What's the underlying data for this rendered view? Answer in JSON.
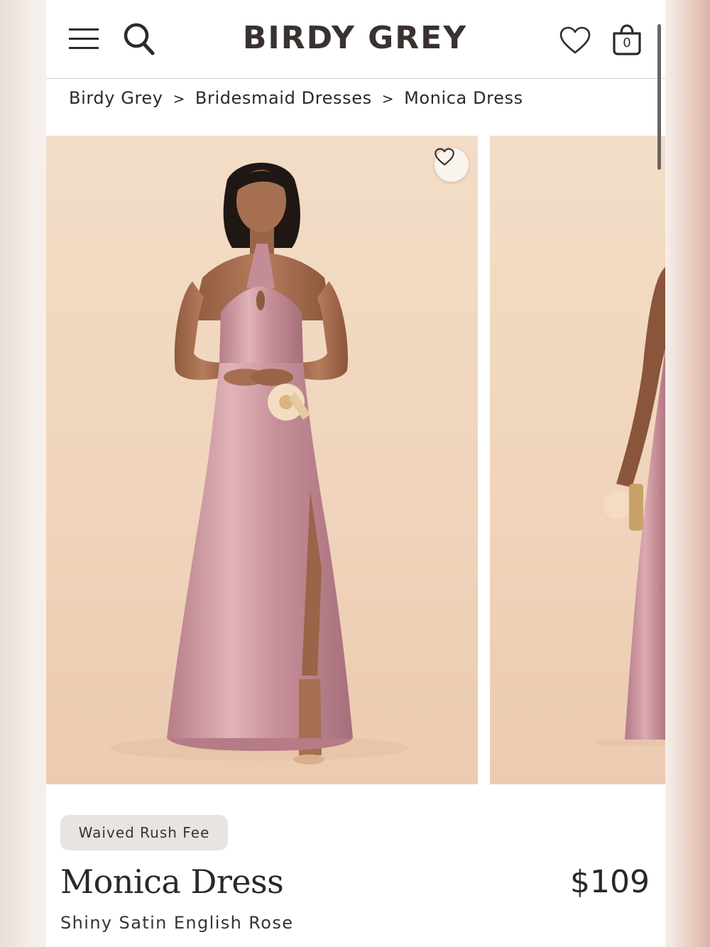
{
  "header": {
    "logo": "BIRDY GREY",
    "bag_count": "0",
    "icons": [
      "menu-icon",
      "search-icon",
      "heart-icon",
      "shopping-bag-icon"
    ]
  },
  "breadcrumb": {
    "items": [
      "Birdy Grey",
      "Bridesmaid Dresses",
      "Monica Dress"
    ],
    "separator": ">"
  },
  "gallery": {
    "favorite_icon": "heart-icon",
    "slide_count_visible": 2
  },
  "product": {
    "badge": "Waived Rush Fee",
    "name": "Monica Dress",
    "price": "$109",
    "variant": "Shiny Satin English Rose"
  },
  "colors": {
    "text": "#2c2725",
    "logo": "#3a3230",
    "photo_background": "#f0d4bb",
    "dress": "#c98f98",
    "badge_background": "#eae4e1"
  }
}
